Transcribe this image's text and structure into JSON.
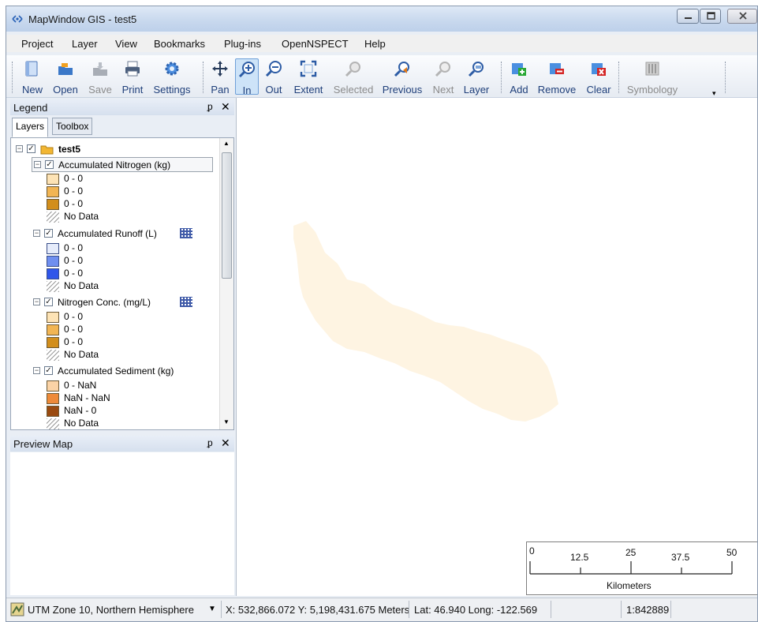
{
  "window": {
    "title": "MapWindow GIS  - test5"
  },
  "menu": [
    "Project",
    "Layer",
    "View",
    "Bookmarks",
    "Plug-ins",
    "OpenNSPECT",
    "Help"
  ],
  "toolbar": {
    "new": "New",
    "open": "Open",
    "save": "Save",
    "print": "Print",
    "settings": "Settings",
    "pan": "Pan",
    "zoom_in": "In",
    "zoom_out": "Out",
    "extent": "Extent",
    "selected": "Selected",
    "previous": "Previous",
    "next": "Next",
    "layer": "Layer",
    "add": "Add",
    "remove": "Remove",
    "clear": "Clear",
    "symbology": "Symbology"
  },
  "legend": {
    "title": "Legend",
    "tabs": {
      "layers": "Layers",
      "toolbox": "Toolbox"
    },
    "group": "test5",
    "layers": [
      {
        "name": "Accumulated Nitrogen (kg)",
        "items": [
          "0 - 0",
          "0 - 0",
          "0 - 0"
        ],
        "colors": [
          "#fde3b5",
          "#f2b553",
          "#d28e1c"
        ],
        "nodata": "No Data"
      },
      {
        "name": "Accumulated Runoff (L)",
        "items": [
          "0 - 0",
          "0 - 0",
          "0 - 0"
        ],
        "colors": [
          "#e6ecfb",
          "#6f8ff0",
          "#2f56ea"
        ],
        "nodata": "No Data"
      },
      {
        "name": "Nitrogen Conc. (mg/L)",
        "items": [
          "0 - 0",
          "0 - 0",
          "0 - 0"
        ],
        "colors": [
          "#fde3b5",
          "#f2b553",
          "#d28e1c"
        ],
        "nodata": "No Data"
      },
      {
        "name": "Accumulated Sediment (kg)",
        "items": [
          "0 - NaN",
          "NaN - NaN",
          "NaN - 0"
        ],
        "colors": [
          "#fbd3a6",
          "#ee8a39",
          "#9a4a10"
        ],
        "nodata": "No Data"
      }
    ]
  },
  "preview": {
    "title": "Preview Map"
  },
  "scalebar": {
    "ticks": [
      "0",
      "12.5",
      "25",
      "37.5",
      "50"
    ],
    "unit": "Kilometers"
  },
  "status": {
    "projection": "UTM Zone 10, Northern Hemisphere",
    "coords": "X: 532,866.072 Y: 5,198,431.675 Meters",
    "latlong": "Lat: 46.940 Long: -122.569",
    "scale": "1:842889"
  },
  "colors": {
    "watershed_fill": "#fef4e2",
    "accent": "#1f3f7a"
  }
}
